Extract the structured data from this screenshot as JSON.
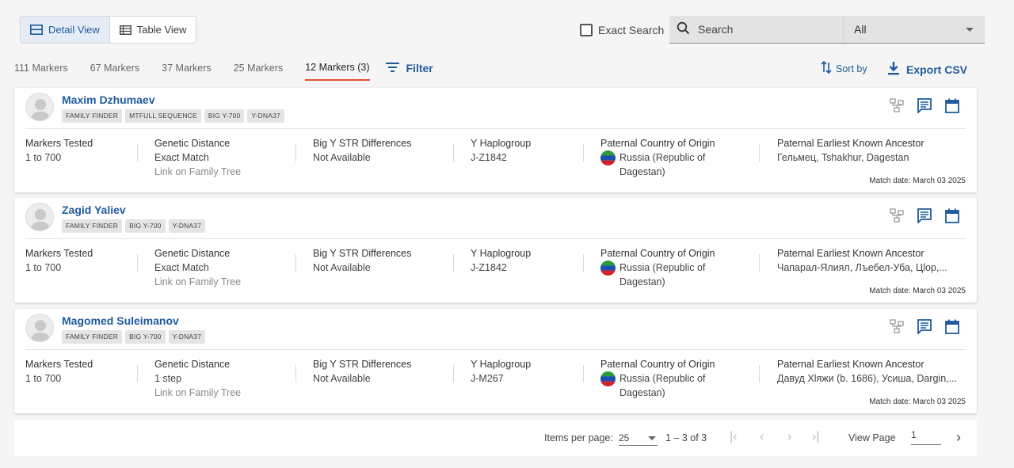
{
  "toolbar": {
    "detail_view": "Detail View",
    "table_view": "Table View",
    "exact_search": "Exact Search",
    "search_placeholder": "Search",
    "filter_select": "All"
  },
  "tabs": [
    {
      "label": "111 Markers",
      "active": false
    },
    {
      "label": "67 Markers",
      "active": false
    },
    {
      "label": "37 Markers",
      "active": false
    },
    {
      "label": "25 Markers",
      "active": false
    },
    {
      "label": "12 Markers (3)",
      "active": true
    }
  ],
  "filter_label": "Filter",
  "sort_label": "Sort by",
  "export_label": "Export CSV",
  "field_labels": {
    "markers": "Markers Tested",
    "distance": "Genetic Distance",
    "bigy": "Big Y STR Differences",
    "haplo": "Y Haplogroup",
    "country": "Paternal Country of Origin",
    "ancestor": "Paternal Earliest Known Ancestor"
  },
  "link_family_tree": "Link on Family Tree",
  "matches": [
    {
      "name": "Maxim Dzhumaev",
      "badges": [
        "FAMILY FINDER",
        "MTFULL SEQUENCE",
        "BIG Y-700",
        "Y-DNA37"
      ],
      "markers": "1 to 700",
      "distance": "Exact Match",
      "bigy": "Not Available",
      "haplo": "J-Z1842",
      "country_line1": "Russia (Republic of",
      "country_line2": "Dagestan)",
      "ancestor": "Гельмец, Tshakhur, Dagestan",
      "match_date": "Match date: March 03 2025"
    },
    {
      "name": "Zagid Yaliev",
      "badges": [
        "FAMILY FINDER",
        "BIG Y-700",
        "Y-DNA37"
      ],
      "markers": "1 to 700",
      "distance": "Exact Match",
      "bigy": "Not Available",
      "haplo": "J-Z1842",
      "country_line1": "Russia (Republic of",
      "country_line2": "Dagestan)",
      "ancestor": "Чапарал-Ялиял, Лъебел-Уба, Цlор,...",
      "match_date": "Match date: March 03 2025"
    },
    {
      "name": "Magomed Suleimanov",
      "badges": [
        "FAMILY FINDER",
        "BIG Y-700",
        "Y-DNA37"
      ],
      "markers": "1 to 700",
      "distance": "1 step",
      "bigy": "Not Available",
      "haplo": "J-M267",
      "country_line1": "Russia (Republic of",
      "country_line2": "Dagestan)",
      "ancestor": "Давуд Хlяжи (b. 1686), Усиша, Dargin,...",
      "match_date": "Match date: March 03 2025"
    }
  ],
  "pagination": {
    "items_per_page_label": "Items per page:",
    "items_per_page": "25",
    "range": "1 – 3 of 3",
    "view_page_label": "View Page",
    "page": "1"
  },
  "colors": {
    "accent": "#1f5a9e",
    "active_tab_underline": "#e3522c",
    "background": "#f5f5f5"
  },
  "icons": [
    "detail-view-icon",
    "table-view-icon",
    "search-icon",
    "filter-icon",
    "sort-icon",
    "download-icon",
    "tree-icon",
    "notes-icon",
    "calendar-icon",
    "avatar-icon",
    "dagestan-flag-icon",
    "first-page-icon",
    "prev-page-icon",
    "next-page-icon",
    "last-page-icon"
  ]
}
